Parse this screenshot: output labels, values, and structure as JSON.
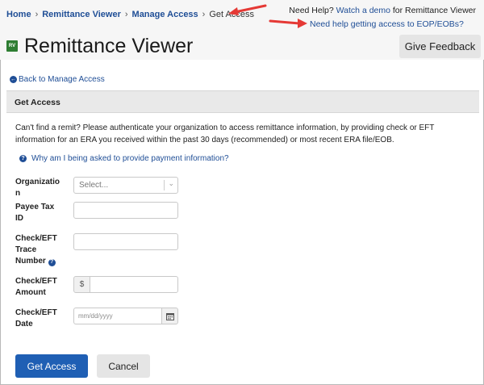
{
  "breadcrumb": {
    "items": [
      {
        "label": "Home",
        "link": true
      },
      {
        "label": "Remittance Viewer",
        "link": true
      },
      {
        "label": "Manage Access",
        "link": true
      },
      {
        "label": "Get Access",
        "link": false
      }
    ],
    "separator": "›"
  },
  "help": {
    "prefix": "Need Help?",
    "demo_link": "Watch a demo",
    "suffix": "for Remittance Viewer",
    "access_link": "Need help getting access to EOP/EOBs?"
  },
  "app": {
    "logo_text": "RV",
    "logo_color": "#2e7d32",
    "title": "Remittance Viewer",
    "feedback_label": "Give Feedback"
  },
  "back_link": "Back to Manage Access",
  "section": {
    "title": "Get Access",
    "intro": "Can't find a remit? Please authenticate your organization to access remittance information, by providing check or EFT information for an ERA you received within the past 30 days (recommended) or most recent ERA file/EOB.",
    "why_link": "Why am I being asked to provide payment information?"
  },
  "form": {
    "organization_label": "Organization",
    "organization_select": "Select...",
    "payee_label": "Payee Tax ID",
    "trace_label": "Check/EFT Trace Number",
    "amount_label": "Check/EFT Amount",
    "amount_prefix": "$",
    "date_label": "Check/EFT Date",
    "date_placeholder": "mm/dd/yyyy"
  },
  "actions": {
    "submit_label": "Get Access",
    "cancel_label": "Cancel"
  },
  "colors": {
    "link": "#1f4e96",
    "primary": "#1f5fb4",
    "annotation_arrow": "#e53935"
  }
}
